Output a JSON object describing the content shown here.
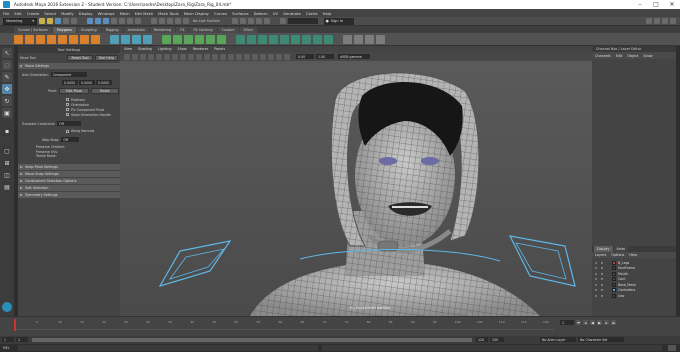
{
  "titlebar": {
    "title": "Autodesk Maya 2016 Extension 2 - Student Version: C:\\Users\\andre\\Desktop\\Zara_Rig\\Zara_Rig_04.mb*"
  },
  "menubar": {
    "items": [
      "File",
      "Edit",
      "Create",
      "Select",
      "Modify",
      "Display",
      "Windows",
      "Mesh",
      "Edit Mesh",
      "Mesh Tools",
      "Mesh Display",
      "Curves",
      "Surfaces",
      "Deform",
      "UV",
      "Generate",
      "Cache",
      "Help"
    ]
  },
  "statusline": {
    "mode": "Modeling",
    "live_surface": "No Live Surface",
    "signin": "Sign In"
  },
  "shelf": {
    "tabs": [
      "Curves / Surfaces",
      "Polygons",
      "Sculpting",
      "Rigging",
      "Animation",
      "Rendering",
      "FX",
      "FX Caching",
      "Custom",
      "XGen"
    ],
    "active_tab": "Polygons"
  },
  "toolbox": {
    "label_move": "Move Tool"
  },
  "tool_settings": {
    "title": "Tool Settings",
    "tool_name": "Move Tool",
    "reset_label": "Reset Tool",
    "help_label": "Tool Help",
    "sections": [
      "Move Settings",
      "Snap Pivot Settings",
      "Move Snap Settings",
      "Constrained Selection Options",
      "Soft Selection",
      "Symmetry Settings"
    ],
    "axis_orientation_label": "Axis Orientation:",
    "axis_orientation_value": "Component",
    "pivot_label": "Pivot:",
    "edit_pivot": "Edit Pivot",
    "reset_pivot": "Reset",
    "checkboxes": [
      "Positions",
      "Orientation",
      "Pin Component Pivot",
      "Show Orientation Handle"
    ],
    "translate_constraint_label": "Translate Constraint:",
    "translate_constraint_value": "Off",
    "along_normals": "Along Normals",
    "step_snap_label": "Step Snap:",
    "step_snap_value": "Off",
    "preserve_children": "Preserve Children:",
    "preserve_uvs": "Preserve UVs:",
    "tweak_mode": "Tweak Mode:",
    "value_fields": [
      "0.0000",
      "0.0000",
      "0.0000"
    ]
  },
  "viewport": {
    "menu": [
      "View",
      "Shading",
      "Lighting",
      "Show",
      "Renderer",
      "Panels"
    ],
    "gamma_value": "sRGB gamma",
    "camera_label": "persp",
    "bottom_label": "(0) PlaceHolder gamma",
    "field_values": [
      "0.00",
      "1.00"
    ]
  },
  "channel_box": {
    "title": "Channel Box / Layer Editor",
    "menu": [
      "Channels",
      "Edit",
      "Object",
      "Show"
    ],
    "layer_tabs": [
      "Display",
      "Anim"
    ],
    "layer_menu": [
      "Layers",
      "Options",
      "Help"
    ],
    "layers": [
      {
        "name": "N_Legs",
        "color": "#d23b3b"
      },
      {
        "name": "FaceFrame",
        "color": "#444444"
      },
      {
        "name": "Mouth",
        "color": "#444444"
      },
      {
        "name": "Cont",
        "color": "#444444"
      },
      {
        "name": "Base_Mesh",
        "color": "#444444"
      },
      {
        "name": "Controllers",
        "color": "#56a7d8"
      },
      {
        "name": "Geo",
        "color": "#444444"
      }
    ]
  },
  "timeline": {
    "ticks": [
      "5",
      "10",
      "15",
      "20",
      "25",
      "30",
      "35",
      "40",
      "45",
      "50",
      "55",
      "60",
      "65",
      "70",
      "75",
      "80",
      "85",
      "90",
      "95",
      "100",
      "105",
      "110",
      "115",
      "120"
    ],
    "current_frame": "1",
    "start": "1",
    "end": "120",
    "range_start": "1",
    "range_end": "200",
    "anim_layer": "No Anim Layer",
    "char_set": "No Character Set",
    "cmd_mode": "MEL"
  },
  "colors": {
    "accent": "#5285a6",
    "active_tab": "#5d5d5d"
  }
}
